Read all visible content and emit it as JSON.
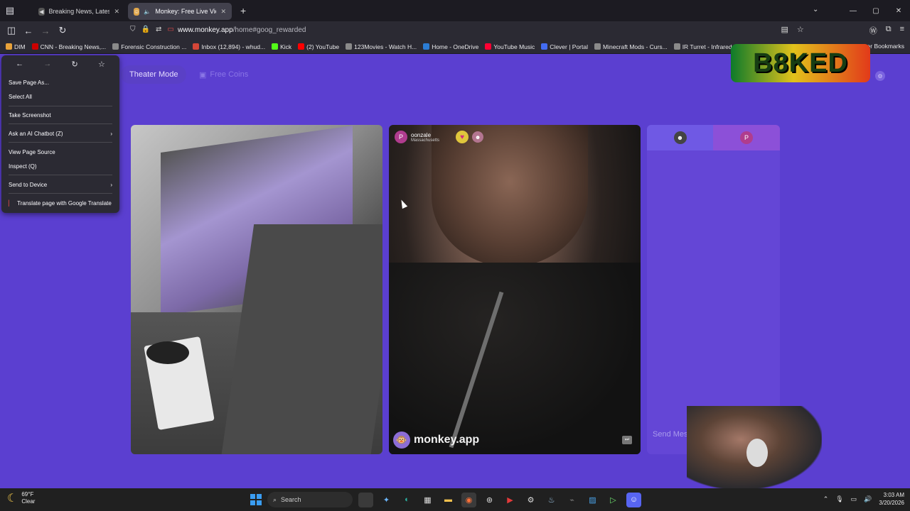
{
  "browser": {
    "tabs": [
      {
        "title": "Breaking News, Latest New",
        "close": "✕"
      },
      {
        "title": "Monkey: Free Live Video Ch",
        "close": "✕"
      }
    ],
    "new_tab": "+",
    "url_host": "www.monkey.app",
    "url_path": "/home#goog_rewarded",
    "window_controls": [
      "—",
      "▢",
      "✕"
    ],
    "bookmarks": [
      {
        "label": "DIM",
        "color": "#e8a23a"
      },
      {
        "label": "CNN - Breaking News,...",
        "color": "#cc0000"
      },
      {
        "label": "Forensic Construction ...",
        "color": "#8a8a8a"
      },
      {
        "label": "Inbox (12,894) - whud...",
        "color": "#d44638"
      },
      {
        "label": "Kick",
        "color": "#53fc18"
      },
      {
        "label": "(2) YouTube",
        "color": "#ff0000"
      },
      {
        "label": "123Movies - Watch H...",
        "color": "#8a8a8a"
      },
      {
        "label": "Home - OneDrive",
        "color": "#2b7cd3"
      },
      {
        "label": "YouTube Music",
        "color": "#ff0033"
      },
      {
        "label": "Clever | Portal",
        "color": "#436cf2"
      },
      {
        "label": "Minecraft Mods - Curs...",
        "color": "#8a8a8a"
      },
      {
        "label": "IR Turret - Infrared Co...",
        "color": "#8a8a8a"
      }
    ],
    "other_bookmarks": "Other Bookmarks"
  },
  "page": {
    "theater_mode": "Theater Mode",
    "free_coins": "Free Coins",
    "remote_user": {
      "badge": "P",
      "name": "oonzale",
      "location": "Massachusetts"
    },
    "watermark": "monkey.app",
    "chat_badge": "P",
    "send_placeholder": "Send Message"
  },
  "context_menu": {
    "items": [
      {
        "label": "Save Page As...",
        "arrow": ""
      },
      {
        "label": "Select All",
        "arrow": ""
      },
      {
        "label": "Take Screenshot",
        "arrow": ""
      },
      {
        "label": "Ask an AI Chatbot (Z)",
        "arrow": "›"
      },
      {
        "label": "View Page Source",
        "arrow": ""
      },
      {
        "label": "Inspect (Q)",
        "arrow": ""
      },
      {
        "label": "Send to Device",
        "arrow": "›"
      },
      {
        "label": "Translate page with Google Translate",
        "arrow": ""
      }
    ]
  },
  "overlay_logo": "B8KED",
  "taskbar": {
    "temp": "69°F",
    "condition": "Clear",
    "search": "Search",
    "time": "3:03 AM",
    "date": "3/20/2026"
  },
  "colors": {
    "page_bg": "#5b3fd0",
    "chat_bg": "#6446d6",
    "browser_chrome": "#2b2a33"
  }
}
